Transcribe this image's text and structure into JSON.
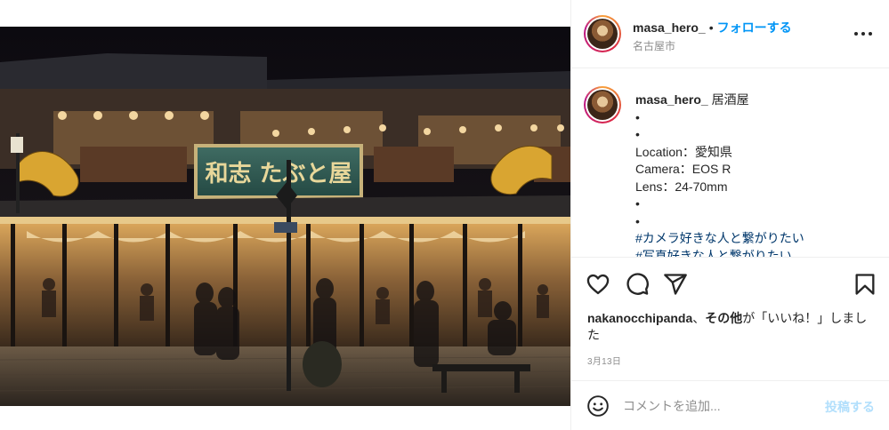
{
  "header": {
    "username": "masa_hero_",
    "separator": "•",
    "follow_label": "フォローする",
    "location": "名古屋市"
  },
  "caption": {
    "username": "masa_hero_",
    "title": "居酒屋",
    "lines": [
      "•",
      "•",
      "Location：愛知県",
      "Camera：EOS R",
      "Lens：24-70mm",
      "•",
      "•"
    ],
    "hashtags": [
      "#カメラ好きな人と繋がりたい",
      "#写真好きな人と繋がりたい"
    ]
  },
  "post_image": {
    "sign_text": "和志 たぶと屋"
  },
  "likes": {
    "user": "nakanocchipanda",
    "connector": "、",
    "others": "その他",
    "suffix": "が「いいね！」しました"
  },
  "date": "3月13日",
  "comment": {
    "placeholder": "コメントを追加...",
    "post_label": "投稿する"
  },
  "colors": {
    "accent": "#0095f6",
    "hashtag": "#00376b",
    "muted": "#8e8e8e",
    "post_disabled": "#b2dffc"
  },
  "icons": [
    "more-icon",
    "heart-icon",
    "comment-icon",
    "share-icon",
    "bookmark-icon",
    "emoji-icon"
  ]
}
